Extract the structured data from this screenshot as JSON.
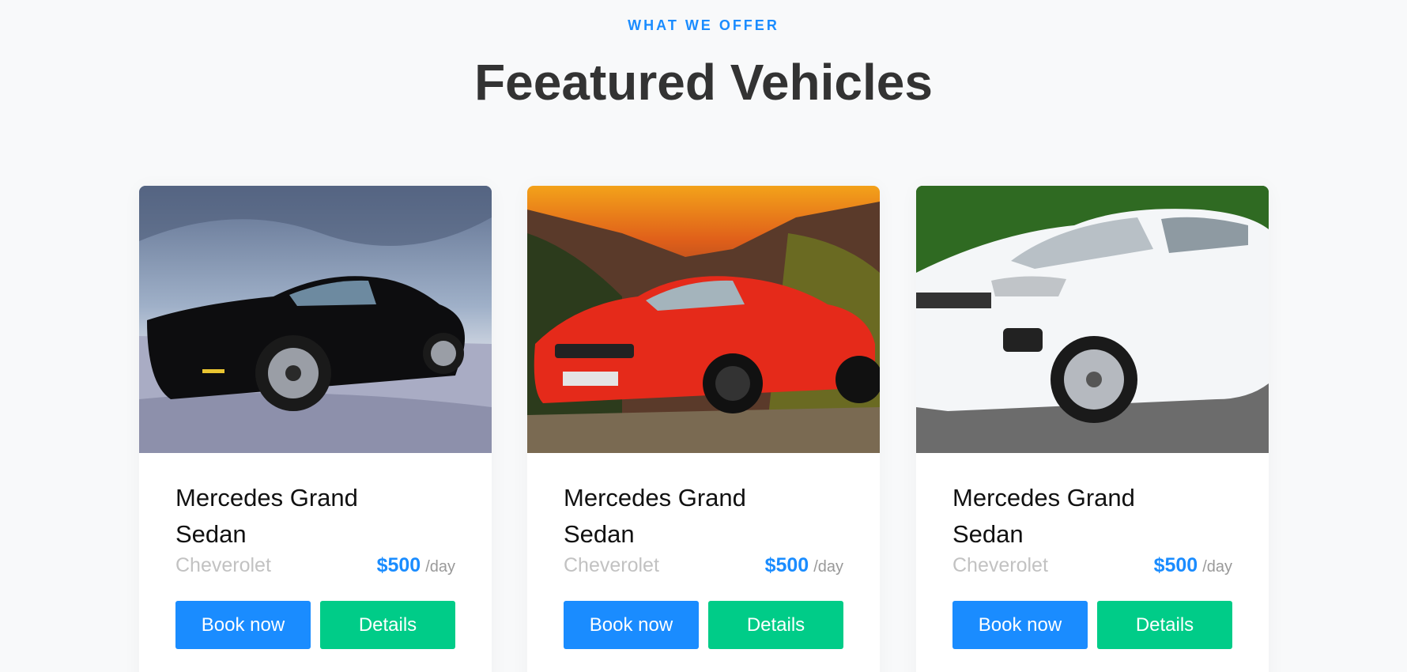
{
  "section": {
    "eyebrow": "WHAT WE OFFER",
    "title": "Feeatured Vehicles"
  },
  "colors": {
    "accent": "#1a8cff",
    "details_button": "#00cc88",
    "heading": "#333333",
    "muted": "#c2c2c2",
    "background": "#f8f9fa"
  },
  "cards": [
    {
      "image_icon": "black-sports-car-photo",
      "name": "Mercedes Grand Sedan",
      "brand": "Cheverolet",
      "price": "$500",
      "period": "/day",
      "book_label": "Book now",
      "details_label": "Details"
    },
    {
      "image_icon": "red-convertible-photo",
      "name": "Mercedes Grand Sedan",
      "brand": "Cheverolet",
      "price": "$500",
      "period": "/day",
      "book_label": "Book now",
      "details_label": "Details"
    },
    {
      "image_icon": "white-suv-photo",
      "name": "Mercedes Grand Sedan",
      "brand": "Cheverolet",
      "price": "$500",
      "period": "/day",
      "book_label": "Book now",
      "details_label": "Details"
    }
  ]
}
